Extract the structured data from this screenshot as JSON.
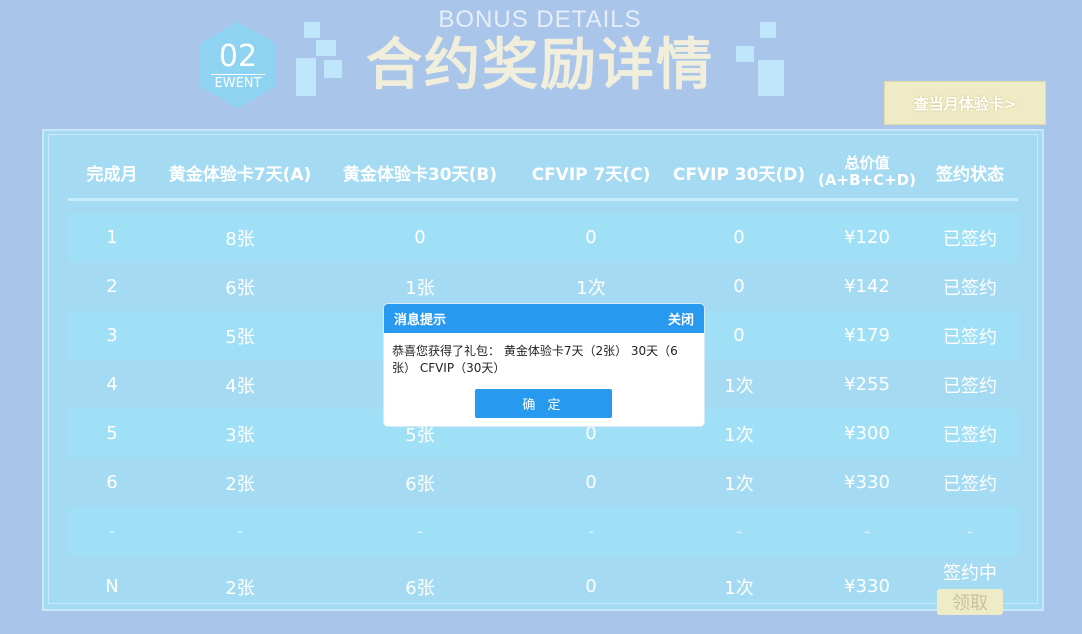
{
  "header": {
    "badge_number": "02",
    "badge_label": "EWENT",
    "title_en": "BONUS DETAILS",
    "title_cn": "合约奖励详情",
    "card_button": "查当月体验卡>"
  },
  "table": {
    "columns": [
      "完成月",
      "黄金体验卡7天(A)",
      "黄金体验卡30天(B)",
      "CFVIP 7天(C)",
      "CFVIP 30天(D)",
      "总价值",
      "(A+B+C+D)",
      "签约状态"
    ],
    "rows": [
      {
        "month": "1",
        "a": "8张",
        "b": "0",
        "c": "0",
        "d": "0",
        "total": "¥120",
        "status": "已签约"
      },
      {
        "month": "2",
        "a": "6张",
        "b": "1张",
        "c": "1次",
        "d": "0",
        "total": "¥142",
        "status": "已签约"
      },
      {
        "month": "3",
        "a": "5张",
        "b": "",
        "c": "",
        "d": "0",
        "total": "¥179",
        "status": "已签约"
      },
      {
        "month": "4",
        "a": "4张",
        "b": "",
        "c": "",
        "d": "1次",
        "total": "¥255",
        "status": "已签约"
      },
      {
        "month": "5",
        "a": "3张",
        "b": "5张",
        "c": "0",
        "d": "1次",
        "total": "¥300",
        "status": "已签约"
      },
      {
        "month": "6",
        "a": "2张",
        "b": "6张",
        "c": "0",
        "d": "1次",
        "total": "¥330",
        "status": "已签约"
      },
      {
        "month": "-",
        "a": "-",
        "b": "-",
        "c": "-",
        "d": "-",
        "total": "-",
        "status": "-"
      },
      {
        "month": "N",
        "a": "2张",
        "b": "6张",
        "c": "0",
        "d": "1次",
        "total": "¥330",
        "status": "签约中"
      }
    ],
    "claim_button": "领取"
  },
  "dialog": {
    "title": "消息提示",
    "close": "关闭",
    "message": "恭喜您获得了礼包： 黄金体验卡7天（2张） 30天（6张） CFVIP（30天）",
    "ok": "确 定"
  }
}
